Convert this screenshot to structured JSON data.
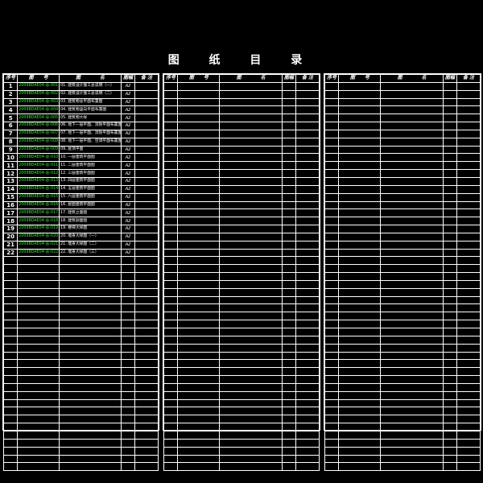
{
  "title": "图 纸 目 录",
  "headers": {
    "no": "序号",
    "code": "图　　号",
    "name": "图　　　　名",
    "size": "图幅",
    "remark": "备 注"
  },
  "rows": [
    {
      "no": "1",
      "code": "2009BDAE04-总-001",
      "name": "01.  建筑设计施工总说明（一）",
      "size": "A2"
    },
    {
      "no": "2",
      "code": "2009BDAE04-总-002",
      "name": "02.  建筑设计施工总说明（二）",
      "size": "A2"
    },
    {
      "no": "3",
      "code": "2009BDAE04-总-003",
      "name": "03.  建筑物总平面布置图",
      "size": "A2"
    },
    {
      "no": "4",
      "code": "2009BDAE04-总-004",
      "name": "04.  建筑物竖向平面布置图",
      "size": "A2"
    },
    {
      "no": "5",
      "code": "2009BDAE04-总-005",
      "name": "05.  建筑物大样",
      "size": "A2"
    },
    {
      "no": "6",
      "code": "2009BDAE04-总-006",
      "name": "06.  地下一层平面、消防平面布置图",
      "size": "A2"
    },
    {
      "no": "7",
      "code": "2009BDAE04-总-007",
      "name": "07.  地下一层平面、消防平面布置图",
      "size": "A2"
    },
    {
      "no": "8",
      "code": "2009BDAE04-总-008",
      "name": "08.  地下一层平面、空调平面布置图",
      "size": "A2"
    },
    {
      "no": "9",
      "code": "2009BDAE04-总-009",
      "name": "09.  屋顶平面",
      "size": "A2"
    },
    {
      "no": "10",
      "code": "2009BDAE04-总-010",
      "name": "10.  一层建筑平面图",
      "size": "A2"
    },
    {
      "no": "11",
      "code": "2009BDAE04-总-011",
      "name": "11.  二层建筑平面图",
      "size": "A2"
    },
    {
      "no": "12",
      "code": "2009BDAE04-总-012",
      "name": "12.  三层建筑平面图",
      "size": "A2"
    },
    {
      "no": "13",
      "code": "2009BDAE04-总-013",
      "name": "13.  四层建筑平面图",
      "size": "A2"
    },
    {
      "no": "14",
      "code": "2009BDAE04-总-014",
      "name": "14.  五层建筑平面图",
      "size": "A2"
    },
    {
      "no": "15",
      "code": "2009BDAE04-总-015",
      "name": "15.  六层建筑平面图",
      "size": "A2"
    },
    {
      "no": "16",
      "code": "2009BDAE04-总-016",
      "name": "16.  屋面建筑平面图",
      "size": "A2"
    },
    {
      "no": "17",
      "code": "2009BDAE04-总-017",
      "name": "17.  建筑立面图",
      "size": "A2"
    },
    {
      "no": "18",
      "code": "2009BDAE04-总-018",
      "name": "18.  建筑剖面图",
      "size": "A2"
    },
    {
      "no": "19",
      "code": "2009BDAE04-总-019",
      "name": "19.  楼梯大样图",
      "size": "A2"
    },
    {
      "no": "20",
      "code": "2009BDAE04-总-020",
      "name": "20.  墙身大样图（一）",
      "size": "A2"
    },
    {
      "no": "21",
      "code": "2009BDAE04-总-021",
      "name": "21.  墙身大样图（二）",
      "size": "A2"
    },
    {
      "no": "22",
      "code": "2009BDAE04-总-022",
      "name": "22.  墙身大样图（三）",
      "size": "A2"
    }
  ],
  "colors": {
    "background": "#000000",
    "lines": "#ffffff",
    "code_text": "#3fdf3f"
  }
}
